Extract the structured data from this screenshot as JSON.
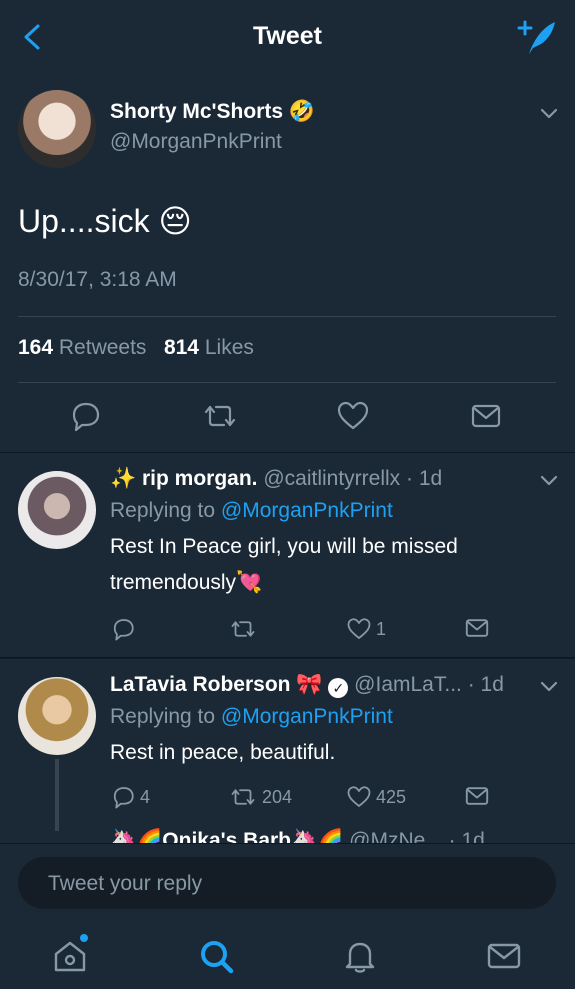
{
  "header": {
    "title": "Tweet",
    "back_icon": "chevron-left-icon",
    "compose_icon": "compose-tweet-icon"
  },
  "main_tweet": {
    "display_name": "Shorty Mc'Shorts 🤣",
    "handle": "@MorganPnkPrint",
    "text": "Up....sick 😔",
    "timestamp": "8/30/17, 3:18 AM",
    "retweets_count": "164",
    "retweets_label": "Retweets",
    "likes_count": "814",
    "likes_label": "Likes"
  },
  "replies": [
    {
      "display_name": "✨ rip morgan.",
      "meta": "@caitlintyrrellx · 1d",
      "replying_prefix": "Replying to ",
      "replying_to": "@MorganPnkPrint",
      "text": "Rest In Peace girl, you will be missed tremendously💘",
      "reply_count": "",
      "retweet_count": "",
      "like_count": "1"
    },
    {
      "display_name": "LaTavia Roberson 🎀",
      "meta": "@IamLaT... · 1d",
      "replying_prefix": "Replying to ",
      "replying_to": "@MorganPnkPrint",
      "text": "Rest in peace, beautiful.",
      "reply_count": "4",
      "retweet_count": "204",
      "like_count": "425"
    },
    {
      "display_name": "🦄🌈Onika's Barb🦄🌈",
      "meta": "@MzNe... · 1d"
    }
  ],
  "reply_bar": {
    "placeholder": "Tweet your reply"
  },
  "colors": {
    "accent": "#1da1f2",
    "background": "#141d26",
    "panel": "#1b2836",
    "muted": "#8899a6",
    "like_pink": "#e0245e"
  }
}
